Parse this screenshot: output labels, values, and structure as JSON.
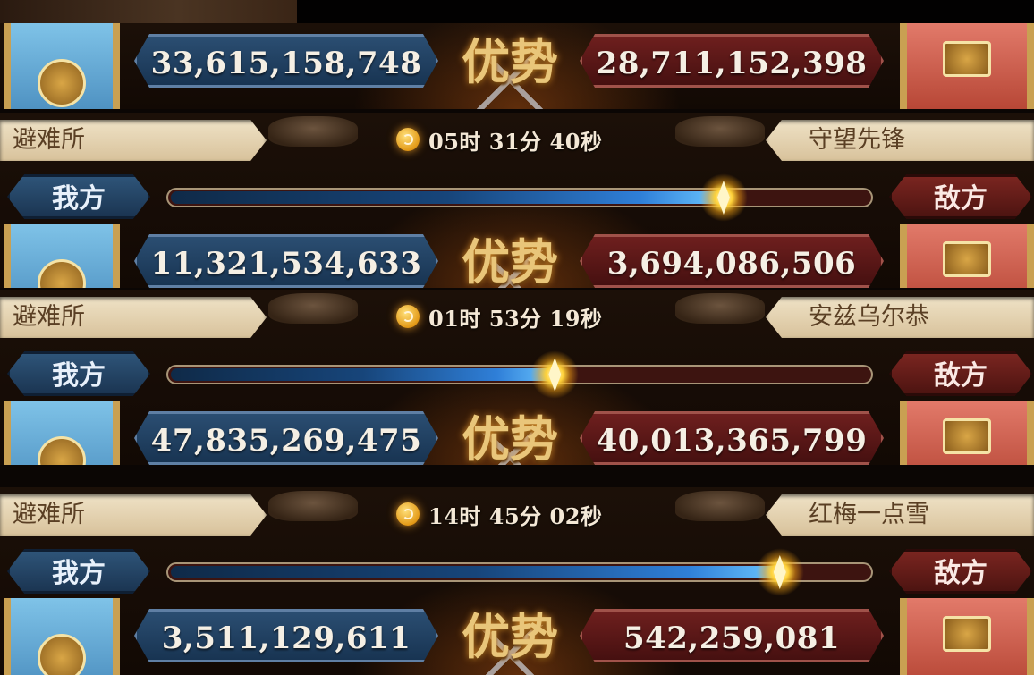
{
  "colors": {
    "ours_accent": "#2f7fd8",
    "enemy_accent": "#8a2a18",
    "advantage_gold": "#e9c67a",
    "plate_beige": "#e6d4b0"
  },
  "icons": {
    "timer": "stopwatch-icon",
    "ours_emblem": "sword-shield-emblem-icon",
    "enemy_emblem": "crown-emblem-icon",
    "crossed_swords": "crossed-swords-icon"
  },
  "segments": [
    {
      "score": {
        "ours": "33,615,158,748",
        "label": "优势",
        "enemy": "28,711,152,398"
      }
    },
    {
      "header": {
        "our_alliance": "避难所",
        "timer": "05时 31分 40秒",
        "enemy_alliance": "守望先锋"
      },
      "progress": {
        "ours_label": "我方",
        "enemy_label": "敌方",
        "ours_share": 0.79
      },
      "score": {
        "ours": "11,321,534,633",
        "label": "优势",
        "enemy": "3,694,086,506"
      }
    },
    {
      "header": {
        "our_alliance": "避难所",
        "timer": "01时 53分 19秒",
        "enemy_alliance": "安兹乌尔恭"
      },
      "progress": {
        "ours_label": "我方",
        "enemy_label": "敌方",
        "ours_share": 0.55
      },
      "score": {
        "ours": "47,835,269,475",
        "label": "优势",
        "enemy": "40,013,365,799"
      }
    },
    {
      "header": {
        "our_alliance": "避难所",
        "timer": "14时 45分 02秒",
        "enemy_alliance": "红梅一点雪"
      },
      "progress": {
        "ours_label": "我方",
        "enemy_label": "敌方",
        "ours_share": 0.87
      },
      "score": {
        "ours": "3,511,129,611",
        "label": "优势",
        "enemy": "542,259,081"
      }
    }
  ]
}
